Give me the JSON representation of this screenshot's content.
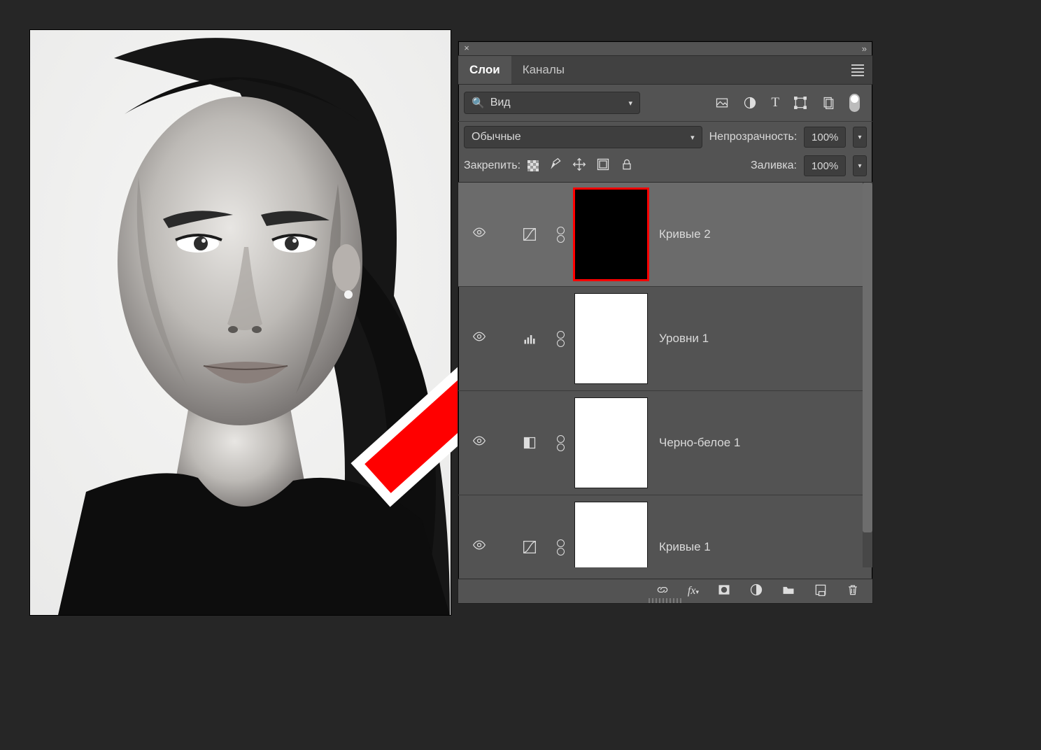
{
  "panel": {
    "tabs": {
      "layers": "Слои",
      "channels": "Каналы"
    },
    "search": {
      "label": "Вид"
    },
    "blend_mode": "Обычные",
    "opacity_label": "Непрозрачность:",
    "opacity_value": "100%",
    "lock_label": "Закрепить:",
    "fill_label": "Заливка:",
    "fill_value": "100%"
  },
  "layers": [
    {
      "name": "Кривые 2",
      "adj": "curves",
      "mask": "black",
      "selected": true,
      "highlight": true
    },
    {
      "name": "Уровни 1",
      "adj": "levels",
      "mask": "white",
      "selected": false,
      "highlight": false
    },
    {
      "name": "Черно-белое 1",
      "adj": "bw",
      "mask": "white",
      "selected": false,
      "highlight": false
    },
    {
      "name": "Кривые 1",
      "adj": "curves",
      "mask": "white",
      "selected": false,
      "highlight": false
    }
  ]
}
